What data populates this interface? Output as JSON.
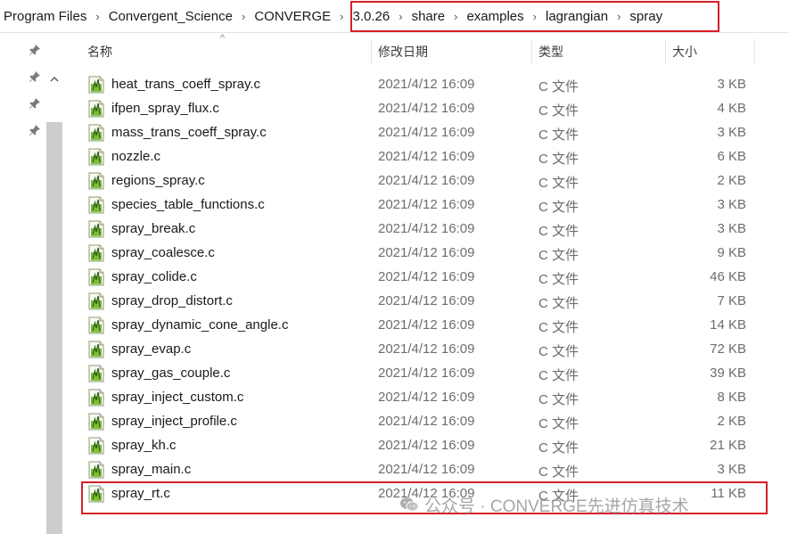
{
  "breadcrumb": {
    "items": [
      "Program Files",
      "Convergent_Science",
      "CONVERGE",
      "3.0.26",
      "share",
      "examples",
      "lagrangian",
      "spray"
    ],
    "separator": "›"
  },
  "columns": {
    "name": "名称",
    "modified": "修改日期",
    "type": "类型",
    "size": "大小",
    "sort_indicator": "^"
  },
  "files": [
    {
      "name": "heat_trans_coeff_spray.c",
      "modified": "2021/4/12 16:09",
      "type": "C 文件",
      "size": "3 KB"
    },
    {
      "name": "ifpen_spray_flux.c",
      "modified": "2021/4/12 16:09",
      "type": "C 文件",
      "size": "4 KB"
    },
    {
      "name": "mass_trans_coeff_spray.c",
      "modified": "2021/4/12 16:09",
      "type": "C 文件",
      "size": "3 KB"
    },
    {
      "name": "nozzle.c",
      "modified": "2021/4/12 16:09",
      "type": "C 文件",
      "size": "6 KB"
    },
    {
      "name": "regions_spray.c",
      "modified": "2021/4/12 16:09",
      "type": "C 文件",
      "size": "2 KB"
    },
    {
      "name": "species_table_functions.c",
      "modified": "2021/4/12 16:09",
      "type": "C 文件",
      "size": "3 KB"
    },
    {
      "name": "spray_break.c",
      "modified": "2021/4/12 16:09",
      "type": "C 文件",
      "size": "3 KB"
    },
    {
      "name": "spray_coalesce.c",
      "modified": "2021/4/12 16:09",
      "type": "C 文件",
      "size": "9 KB"
    },
    {
      "name": "spray_colide.c",
      "modified": "2021/4/12 16:09",
      "type": "C 文件",
      "size": "46 KB"
    },
    {
      "name": "spray_drop_distort.c",
      "modified": "2021/4/12 16:09",
      "type": "C 文件",
      "size": "7 KB"
    },
    {
      "name": "spray_dynamic_cone_angle.c",
      "modified": "2021/4/12 16:09",
      "type": "C 文件",
      "size": "14 KB"
    },
    {
      "name": "spray_evap.c",
      "modified": "2021/4/12 16:09",
      "type": "C 文件",
      "size": "72 KB"
    },
    {
      "name": "spray_gas_couple.c",
      "modified": "2021/4/12 16:09",
      "type": "C 文件",
      "size": "39 KB"
    },
    {
      "name": "spray_inject_custom.c",
      "modified": "2021/4/12 16:09",
      "type": "C 文件",
      "size": "8 KB"
    },
    {
      "name": "spray_inject_profile.c",
      "modified": "2021/4/12 16:09",
      "type": "C 文件",
      "size": "2 KB"
    },
    {
      "name": "spray_kh.c",
      "modified": "2021/4/12 16:09",
      "type": "C 文件",
      "size": "21 KB"
    },
    {
      "name": "spray_main.c",
      "modified": "2021/4/12 16:09",
      "type": "C 文件",
      "size": "3 KB"
    },
    {
      "name": "spray_rt.c",
      "modified": "2021/4/12 16:09",
      "type": "C 文件",
      "size": "11 KB"
    }
  ],
  "watermark": "公众号 · CONVERGE先进仿真技术",
  "colors": {
    "highlight_box": "#d81e2a",
    "secondary_text": "#6d6d6d",
    "icon_green": "#7cbf3a"
  },
  "icons": {
    "file": "c-file-icon",
    "pin": "pin-icon",
    "scroll_up": "chevron-up-icon"
  }
}
